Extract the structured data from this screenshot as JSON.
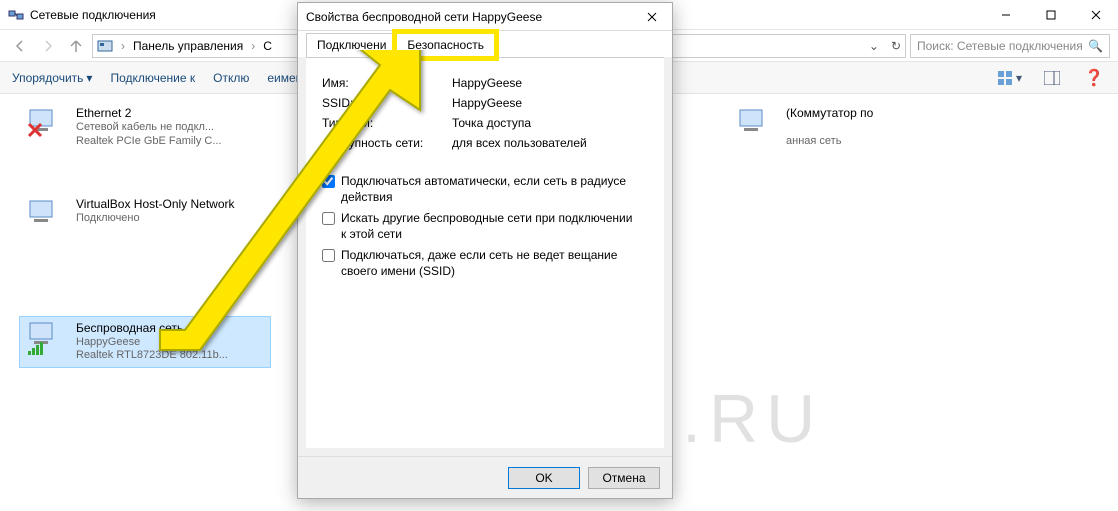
{
  "window": {
    "title": "Сетевые подключения",
    "search_placeholder": "Поиск: Сетевые подключения"
  },
  "breadcrumb": {
    "item1": "Панель управления",
    "item2": "С"
  },
  "toolbar": {
    "organize": "Упорядочить",
    "connect": "Подключение к",
    "disable": "Отклю",
    "rename": "еименование подключения"
  },
  "connections": {
    "eth": {
      "name": "Ethernet 2",
      "line1": "Сетевой кабель не подкл...",
      "line2": "Realtek PCIe GbE Family C..."
    },
    "wifi": {
      "name": "Беспроводная сеть",
      "line1": "HappyGeese",
      "line2": "Realtek RTL8723DE 802.11b..."
    },
    "bridge": {
      "name": "(Коммутатор по",
      "line1": "",
      "line2": "анная сеть"
    },
    "vbox": {
      "name": "VirtualBox Host-Only Network",
      "line1": "Подключено",
      "line2": ""
    }
  },
  "dialog": {
    "title": "Свойства беспроводной сети HappyGeese",
    "tab_connection": "Подключени",
    "tab_security": "Безопасность",
    "fields": {
      "name_label": "Имя:",
      "name_value": "HappyGeese",
      "ssid_label": "SSID:",
      "ssid_value": "HappyGeese",
      "type_label": "Тип сети:",
      "type_value": "Точка доступа",
      "avail_label": "Доступность сети:",
      "avail_value": "для всех пользователей"
    },
    "check1": "Подключаться автоматически, если сеть в радиусе действия",
    "check2": "Искать другие беспроводные сети при подключении к этой сети",
    "check3": "Подключаться, даже если сеть не ведет вещание своего имени (SSID)",
    "ok": "OK",
    "cancel": "Отмена"
  },
  "watermark": "KONEKTO.RU"
}
